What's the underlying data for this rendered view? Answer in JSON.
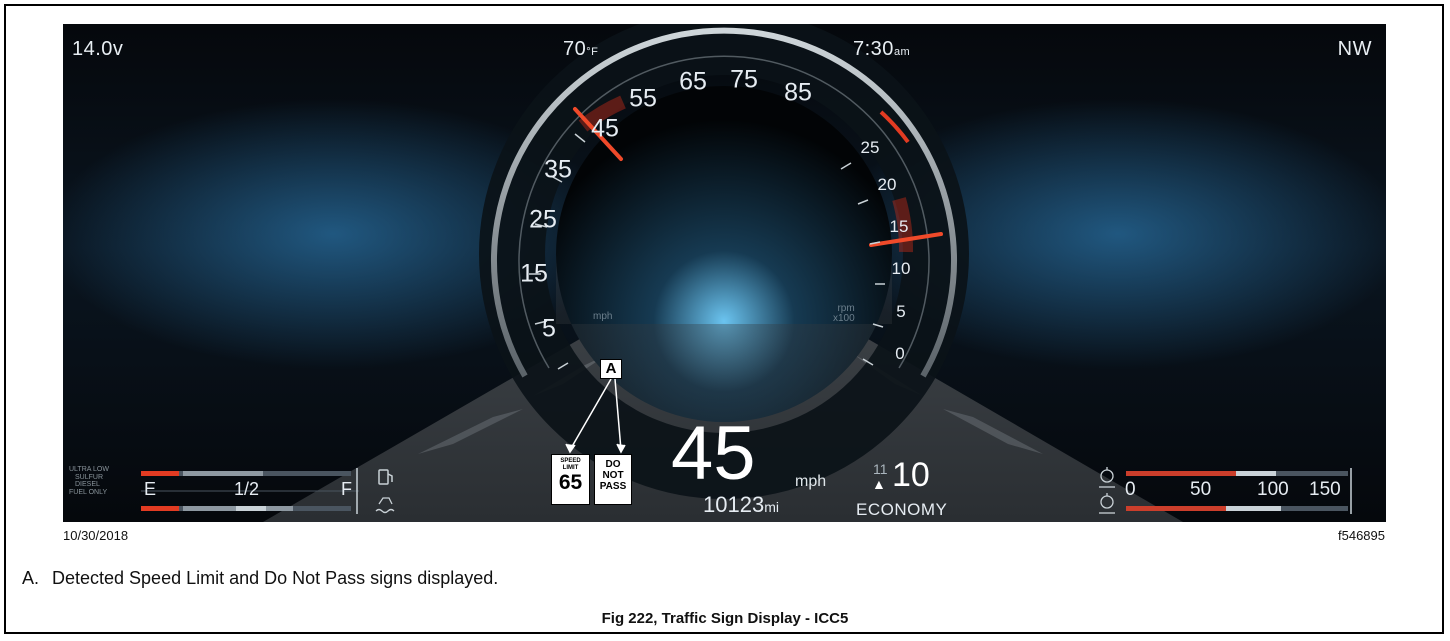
{
  "cluster": {
    "voltage": "14.0v",
    "temperature_value": "70",
    "temperature_unit": "°F",
    "time_value": "7:30",
    "time_suffix": "am",
    "heading": "NW",
    "speedometer": {
      "labels": [
        "5",
        "15",
        "25",
        "35",
        "45",
        "55",
        "65",
        "75",
        "85"
      ],
      "unit": "mph",
      "needle_value": 45
    },
    "tachometer": {
      "labels": [
        "0",
        "5",
        "10",
        "15",
        "20",
        "25"
      ],
      "unit_line1": "rpm",
      "unit_line2": "x100",
      "needle_value": 15
    },
    "speed": "45",
    "speed_unit": "mph",
    "odometer": "10123",
    "odometer_unit": "mi",
    "gear_next": "11",
    "gear_arrow": "▲",
    "gear_current": "10",
    "drive_mode": "ECONOMY",
    "traffic_signs": {
      "speed_limit_caption": "SPEED LIMIT",
      "speed_limit_value": "65",
      "do_not_pass_lines": [
        "DO",
        "NOT",
        "PASS"
      ]
    },
    "callout_label": "A",
    "fuel_gauge": {
      "fuel_note_lines": [
        "ULTRA LOW",
        "SULFUR",
        "DIESEL",
        "FUEL ONLY"
      ],
      "empty_label": "E",
      "half_label": "1/2",
      "full_label": "F",
      "icon": "fuel-pump-icon",
      "def_icon": "def-fluid-icon"
    },
    "air_gauge": {
      "scale": [
        "0",
        "50",
        "100",
        "150"
      ],
      "icon_primary": "air-pressure-primary-icon",
      "icon_secondary": "air-pressure-secondary-icon"
    }
  },
  "footer": {
    "date": "10/30/2018",
    "figure_id": "f546895"
  },
  "caption": {
    "label": "A.",
    "text": "Detected Speed Limit and Do Not Pass signs displayed."
  },
  "figure_title": "Fig 222, Traffic Sign Display - ICC5",
  "colors": {
    "accent_red": "#e23b22",
    "background": "#06101a",
    "text": "#e6ecf2"
  }
}
